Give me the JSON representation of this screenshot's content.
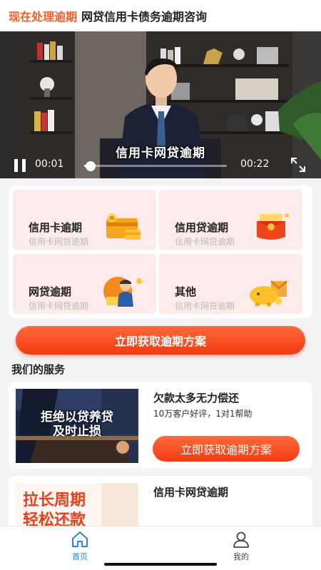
{
  "header": {
    "accent_title": "现在处理逾期",
    "title": "网贷信用卡债务逾期咨询"
  },
  "video": {
    "subtitle": "信用卡网贷逾期",
    "current_time": "00:01",
    "total_time": "00:22",
    "progress": 0.045,
    "icons": {
      "pause": "pause-icon",
      "fullscreen": "fullscreen-icon"
    }
  },
  "categories": [
    {
      "title": "信用卡逾期",
      "subtitle": "信用卡网贷逾期",
      "icon": "credit-card-icon"
    },
    {
      "title": "信用贷逾期",
      "subtitle": "信用卡网贷逾期",
      "icon": "red-envelope-icon"
    },
    {
      "title": "网贷逾期",
      "subtitle": "信用卡网贷逾期",
      "icon": "person-money-icon"
    },
    {
      "title": "其他",
      "subtitle": "信用卡网贷逾期",
      "icon": "piggy-bank-icon"
    }
  ],
  "cta_label": "立即获取逾期方案",
  "section_title": "我们的服务",
  "services": [
    {
      "image_text_line1": "拒绝以贷养贷",
      "image_text_line2": "及时止损",
      "title": "欠款太多无力偿还",
      "subtitle": "10万客户好评，1对1帮助",
      "button": "立即获取逾期方案"
    },
    {
      "image_text_line1": "拉长周期",
      "image_text_line2": "轻松还款",
      "title": "信用卡网贷逾期"
    }
  ],
  "tabbar": {
    "items": [
      {
        "label": "首页",
        "icon": "home-icon",
        "active": true
      },
      {
        "label": "我的",
        "icon": "user-icon",
        "active": false
      }
    ]
  },
  "colors": {
    "accent": "#ff5a1f",
    "button_gradient_top": "#ff6a3a",
    "button_gradient_bottom": "#f23a12",
    "category_bg": "#fbeceb",
    "tab_active": "#2f80ed"
  }
}
